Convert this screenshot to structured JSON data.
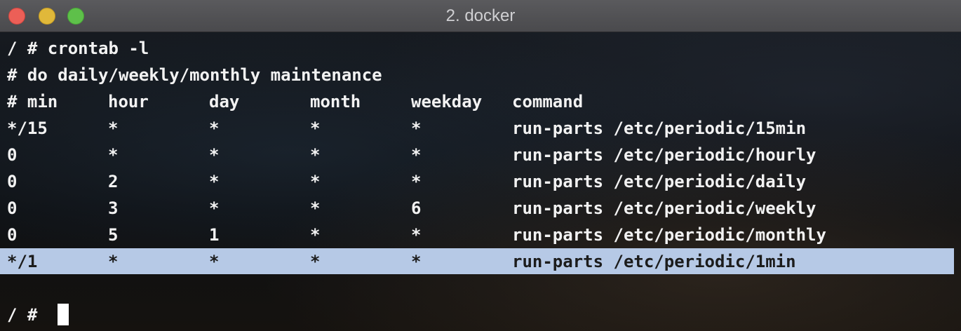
{
  "window": {
    "title": "2. docker"
  },
  "terminal": {
    "command_line": "/ # crontab -l",
    "comment_line": "# do daily/weekly/monthly maintenance",
    "header": {
      "min": "# min",
      "hour": "hour",
      "day": "day",
      "month": "month",
      "weekday": "weekday",
      "command": "command"
    },
    "rows": [
      {
        "min": "*/15",
        "hour": "*",
        "day": "*",
        "month": "*",
        "weekday": "*",
        "command": "run-parts /etc/periodic/15min"
      },
      {
        "min": "0",
        "hour": "*",
        "day": "*",
        "month": "*",
        "weekday": "*",
        "command": "run-parts /etc/periodic/hourly"
      },
      {
        "min": "0",
        "hour": "2",
        "day": "*",
        "month": "*",
        "weekday": "*",
        "command": "run-parts /etc/periodic/daily"
      },
      {
        "min": "0",
        "hour": "3",
        "day": "*",
        "month": "*",
        "weekday": "6",
        "command": "run-parts /etc/periodic/weekly"
      },
      {
        "min": "0",
        "hour": "5",
        "day": "1",
        "month": "*",
        "weekday": "*",
        "command": "run-parts /etc/periodic/monthly"
      },
      {
        "min": "*/1",
        "hour": "*",
        "day": "*",
        "month": "*",
        "weekday": "*",
        "command": "run-parts /etc/periodic/1min"
      }
    ],
    "prompt": "/ #"
  },
  "colors": {
    "selection": "#b6c9e6",
    "text": "#f2f2f2",
    "close": "#ec5f57",
    "minimize": "#e0b83a",
    "maximize": "#5ec04a"
  }
}
